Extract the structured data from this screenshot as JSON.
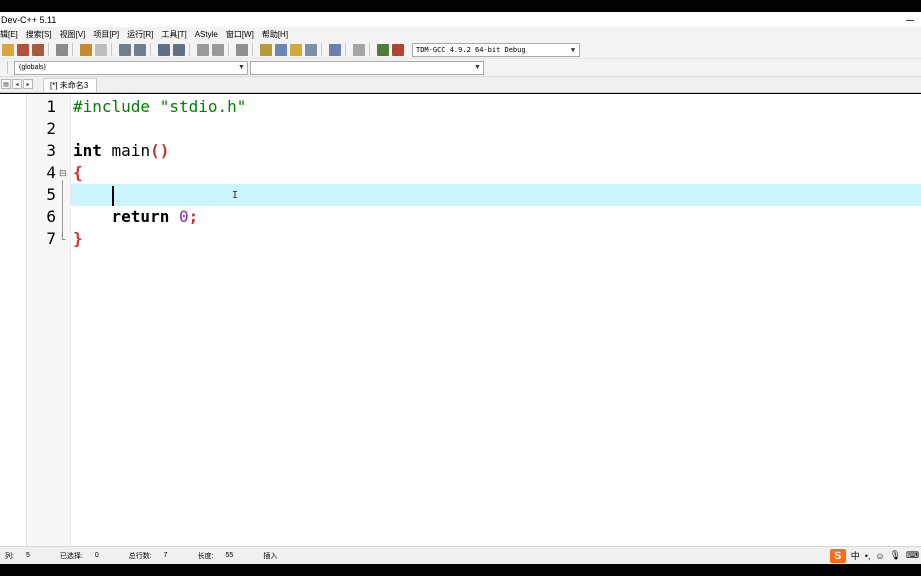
{
  "window": {
    "title": "Dev-C++ 5.11"
  },
  "menu": {
    "items": [
      "辑[E]",
      "搜索[S]",
      "视图[V]",
      "项目[P]",
      "运行[R]",
      "工具[T]",
      "AStyle",
      "窗口[W]",
      "帮助[H]"
    ]
  },
  "toolbar": {
    "compiler_value": "TDM-GCC 4.9.2 64-bit Debug"
  },
  "toolbar2": {
    "scope_value": "(globals)",
    "symbol_value": ""
  },
  "tabs": {
    "file_tab_label": "[*] 未命名3"
  },
  "editor": {
    "line_numbers": [
      "1",
      "2",
      "3",
      "4",
      "5",
      "6",
      "7"
    ],
    "lines": [
      [
        {
          "t": "#include \"stdio.h\"",
          "c": "pre"
        }
      ],
      [],
      [
        {
          "t": "int",
          "c": "kw"
        },
        {
          "t": " main",
          "c": "plain"
        },
        {
          "t": "()",
          "c": "punc"
        }
      ],
      [
        {
          "t": "{",
          "c": "punc"
        }
      ],
      [],
      [
        {
          "t": "    ",
          "c": "plain"
        },
        {
          "t": "return",
          "c": "kw"
        },
        {
          "t": " ",
          "c": "plain"
        },
        {
          "t": "0",
          "c": "num"
        },
        {
          "t": ";",
          "c": "punc"
        }
      ],
      [
        {
          "t": "}",
          "c": "punc"
        }
      ]
    ],
    "current_line": 5
  },
  "status": {
    "col_label": "列:",
    "col_value": "5",
    "selected_label": "已选择:",
    "selected_value": "0",
    "lines_label": "总行数:",
    "lines_value": "7",
    "length_label": "长度:",
    "length_value": "55",
    "mode": "插入"
  },
  "tray": {
    "ime_logo": "S",
    "ime_lang": "中",
    "punct": "•,"
  },
  "colors": {
    "current_line": "#ccf6ff",
    "preprocessor": "#008000",
    "punctuation": "#c9302c",
    "number": "#8b2cae"
  }
}
